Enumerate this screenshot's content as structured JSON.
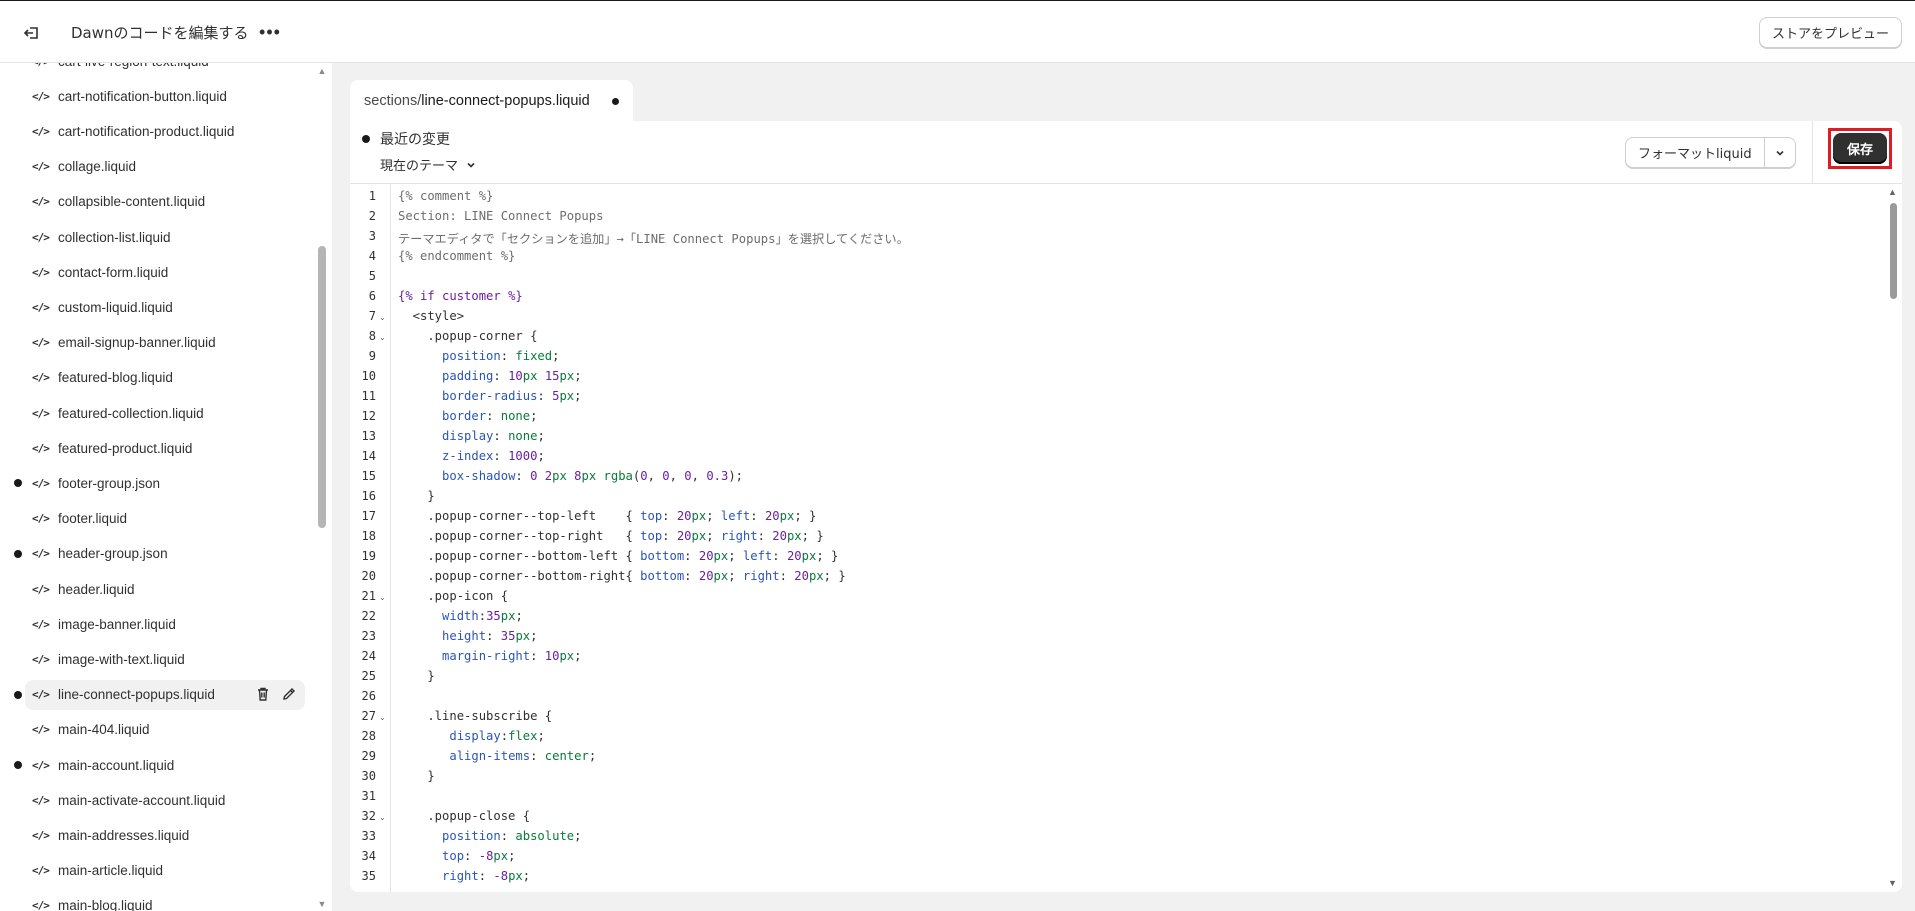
{
  "header": {
    "title": "Dawnのコードを編集する",
    "more_label": "•••",
    "preview_label": "ストアをプレビュー"
  },
  "sidebar": {
    "files": [
      {
        "name": "cart-live-region-text.liquid",
        "modified": false
      },
      {
        "name": "cart-notification-button.liquid",
        "modified": false
      },
      {
        "name": "cart-notification-product.liquid",
        "modified": false
      },
      {
        "name": "collage.liquid",
        "modified": false
      },
      {
        "name": "collapsible-content.liquid",
        "modified": false
      },
      {
        "name": "collection-list.liquid",
        "modified": false
      },
      {
        "name": "contact-form.liquid",
        "modified": false
      },
      {
        "name": "custom-liquid.liquid",
        "modified": false
      },
      {
        "name": "email-signup-banner.liquid",
        "modified": false
      },
      {
        "name": "featured-blog.liquid",
        "modified": false
      },
      {
        "name": "featured-collection.liquid",
        "modified": false
      },
      {
        "name": "featured-product.liquid",
        "modified": false
      },
      {
        "name": "footer-group.json",
        "modified": true
      },
      {
        "name": "footer.liquid",
        "modified": false
      },
      {
        "name": "header-group.json",
        "modified": true
      },
      {
        "name": "header.liquid",
        "modified": false
      },
      {
        "name": "image-banner.liquid",
        "modified": false
      },
      {
        "name": "image-with-text.liquid",
        "modified": false
      },
      {
        "name": "line-connect-popups.liquid",
        "modified": true,
        "active": true
      },
      {
        "name": "main-404.liquid",
        "modified": false
      },
      {
        "name": "main-account.liquid",
        "modified": true
      },
      {
        "name": "main-activate-account.liquid",
        "modified": false
      },
      {
        "name": "main-addresses.liquid",
        "modified": false
      },
      {
        "name": "main-article.liquid",
        "modified": false
      },
      {
        "name": "main-blog.liquid",
        "modified": false
      }
    ]
  },
  "editor": {
    "tab_path": "sections/",
    "tab_file": "line-connect-popups.liquid",
    "recent_changes": "最近の変更",
    "theme_select": "現在のテーマ",
    "format_label": "フォーマットliquid",
    "save_label": "保存",
    "line_numbers": [
      "1",
      "2",
      "3",
      "4",
      "5",
      "6",
      "7",
      "8",
      "9",
      "10",
      "11",
      "12",
      "13",
      "14",
      "15",
      "16",
      "17",
      "18",
      "19",
      "20",
      "21",
      "22",
      "23",
      "24",
      "25",
      "26",
      "27",
      "28",
      "29",
      "30",
      "31",
      "32",
      "33",
      "34",
      "35"
    ],
    "fold_lines": [
      7,
      8,
      21,
      27,
      32
    ],
    "code_lines": [
      [
        [
          "c",
          "{% comment %}"
        ]
      ],
      [
        [
          "c",
          "Section: LINE Connect Popups"
        ]
      ],
      [
        [
          "c",
          "テーマエディタで「セクションを追加」→「LINE Connect Popups」を選択してください。"
        ]
      ],
      [
        [
          "c",
          "{% endcomment %}"
        ]
      ],
      [],
      [
        [
          "k",
          "{% if "
        ],
        [
          "v",
          "customer"
        ],
        [
          "k",
          " %}"
        ]
      ],
      [
        [
          "t",
          "  <style>"
        ]
      ],
      [
        [
          "t",
          "    .popup-corner {"
        ]
      ],
      [
        [
          "t",
          "      "
        ],
        [
          "p",
          "position"
        ],
        [
          "t",
          ": "
        ],
        [
          "g",
          "fixed"
        ],
        [
          "t",
          ";"
        ]
      ],
      [
        [
          "t",
          "      "
        ],
        [
          "p",
          "padding"
        ],
        [
          "t",
          ": "
        ],
        [
          "n",
          "10"
        ],
        [
          "g",
          "px"
        ],
        [
          "t",
          " "
        ],
        [
          "n",
          "15"
        ],
        [
          "g",
          "px"
        ],
        [
          "t",
          ";"
        ]
      ],
      [
        [
          "t",
          "      "
        ],
        [
          "p",
          "border-radius"
        ],
        [
          "t",
          ": "
        ],
        [
          "n",
          "5"
        ],
        [
          "g",
          "px"
        ],
        [
          "t",
          ";"
        ]
      ],
      [
        [
          "t",
          "      "
        ],
        [
          "p",
          "border"
        ],
        [
          "t",
          ": "
        ],
        [
          "g",
          "none"
        ],
        [
          "t",
          ";"
        ]
      ],
      [
        [
          "t",
          "      "
        ],
        [
          "p",
          "display"
        ],
        [
          "t",
          ": "
        ],
        [
          "g",
          "none"
        ],
        [
          "t",
          ";"
        ]
      ],
      [
        [
          "t",
          "      "
        ],
        [
          "p",
          "z-index"
        ],
        [
          "t",
          ": "
        ],
        [
          "n",
          "1000"
        ],
        [
          "t",
          ";"
        ]
      ],
      [
        [
          "t",
          "      "
        ],
        [
          "p",
          "box-shadow"
        ],
        [
          "t",
          ": "
        ],
        [
          "n",
          "0"
        ],
        [
          "t",
          " "
        ],
        [
          "n",
          "2"
        ],
        [
          "g",
          "px"
        ],
        [
          "t",
          " "
        ],
        [
          "n",
          "8"
        ],
        [
          "g",
          "px"
        ],
        [
          "t",
          " "
        ],
        [
          "g",
          "rgba"
        ],
        [
          "t",
          "("
        ],
        [
          "n",
          "0"
        ],
        [
          "t",
          ", "
        ],
        [
          "n",
          "0"
        ],
        [
          "t",
          ", "
        ],
        [
          "n",
          "0"
        ],
        [
          "t",
          ", "
        ],
        [
          "n",
          "0.3"
        ],
        [
          "t",
          ");"
        ]
      ],
      [
        [
          "t",
          "    }"
        ]
      ],
      [
        [
          "t",
          "    .popup-corner--top-left    { "
        ],
        [
          "p",
          "top"
        ],
        [
          "t",
          ": "
        ],
        [
          "n",
          "20"
        ],
        [
          "g",
          "px"
        ],
        [
          "t",
          "; "
        ],
        [
          "p",
          "left"
        ],
        [
          "t",
          ": "
        ],
        [
          "n",
          "20"
        ],
        [
          "g",
          "px"
        ],
        [
          "t",
          "; }"
        ]
      ],
      [
        [
          "t",
          "    .popup-corner--top-right   { "
        ],
        [
          "p",
          "top"
        ],
        [
          "t",
          ": "
        ],
        [
          "n",
          "20"
        ],
        [
          "g",
          "px"
        ],
        [
          "t",
          "; "
        ],
        [
          "p",
          "right"
        ],
        [
          "t",
          ": "
        ],
        [
          "n",
          "20"
        ],
        [
          "g",
          "px"
        ],
        [
          "t",
          "; }"
        ]
      ],
      [
        [
          "t",
          "    .popup-corner--bottom-left { "
        ],
        [
          "p",
          "bottom"
        ],
        [
          "t",
          ": "
        ],
        [
          "n",
          "20"
        ],
        [
          "g",
          "px"
        ],
        [
          "t",
          "; "
        ],
        [
          "p",
          "left"
        ],
        [
          "t",
          ": "
        ],
        [
          "n",
          "20"
        ],
        [
          "g",
          "px"
        ],
        [
          "t",
          "; }"
        ]
      ],
      [
        [
          "t",
          "    .popup-corner--bottom-right{ "
        ],
        [
          "p",
          "bottom"
        ],
        [
          "t",
          ": "
        ],
        [
          "n",
          "20"
        ],
        [
          "g",
          "px"
        ],
        [
          "t",
          "; "
        ],
        [
          "p",
          "right"
        ],
        [
          "t",
          ": "
        ],
        [
          "n",
          "20"
        ],
        [
          "g",
          "px"
        ],
        [
          "t",
          "; }"
        ]
      ],
      [
        [
          "t",
          "    .pop-icon {"
        ]
      ],
      [
        [
          "t",
          "      "
        ],
        [
          "p",
          "width"
        ],
        [
          "t",
          ":"
        ],
        [
          "n",
          "35"
        ],
        [
          "g",
          "px"
        ],
        [
          "t",
          ";"
        ]
      ],
      [
        [
          "t",
          "      "
        ],
        [
          "p",
          "height"
        ],
        [
          "t",
          ": "
        ],
        [
          "n",
          "35"
        ],
        [
          "g",
          "px"
        ],
        [
          "t",
          ";"
        ]
      ],
      [
        [
          "t",
          "      "
        ],
        [
          "p",
          "margin-right"
        ],
        [
          "t",
          ": "
        ],
        [
          "n",
          "10"
        ],
        [
          "g",
          "px"
        ],
        [
          "t",
          ";"
        ]
      ],
      [
        [
          "t",
          "    }"
        ]
      ],
      [],
      [
        [
          "t",
          "    .line-subscribe {"
        ]
      ],
      [
        [
          "t",
          "       "
        ],
        [
          "p",
          "display"
        ],
        [
          "t",
          ":"
        ],
        [
          "g",
          "flex"
        ],
        [
          "t",
          ";"
        ]
      ],
      [
        [
          "t",
          "       "
        ],
        [
          "p",
          "align-items"
        ],
        [
          "t",
          ": "
        ],
        [
          "g",
          "center"
        ],
        [
          "t",
          ";"
        ]
      ],
      [
        [
          "t",
          "    }"
        ]
      ],
      [],
      [
        [
          "t",
          "    .popup-close {"
        ]
      ],
      [
        [
          "t",
          "      "
        ],
        [
          "p",
          "position"
        ],
        [
          "t",
          ": "
        ],
        [
          "g",
          "absolute"
        ],
        [
          "t",
          ";"
        ]
      ],
      [
        [
          "t",
          "      "
        ],
        [
          "p",
          "top"
        ],
        [
          "t",
          ": "
        ],
        [
          "n",
          "-8"
        ],
        [
          "g",
          "px"
        ],
        [
          "t",
          ";"
        ]
      ],
      [
        [
          "t",
          "      "
        ],
        [
          "p",
          "right"
        ],
        [
          "t",
          ": "
        ],
        [
          "n",
          "-8"
        ],
        [
          "g",
          "px"
        ],
        [
          "t",
          ";"
        ]
      ]
    ]
  }
}
